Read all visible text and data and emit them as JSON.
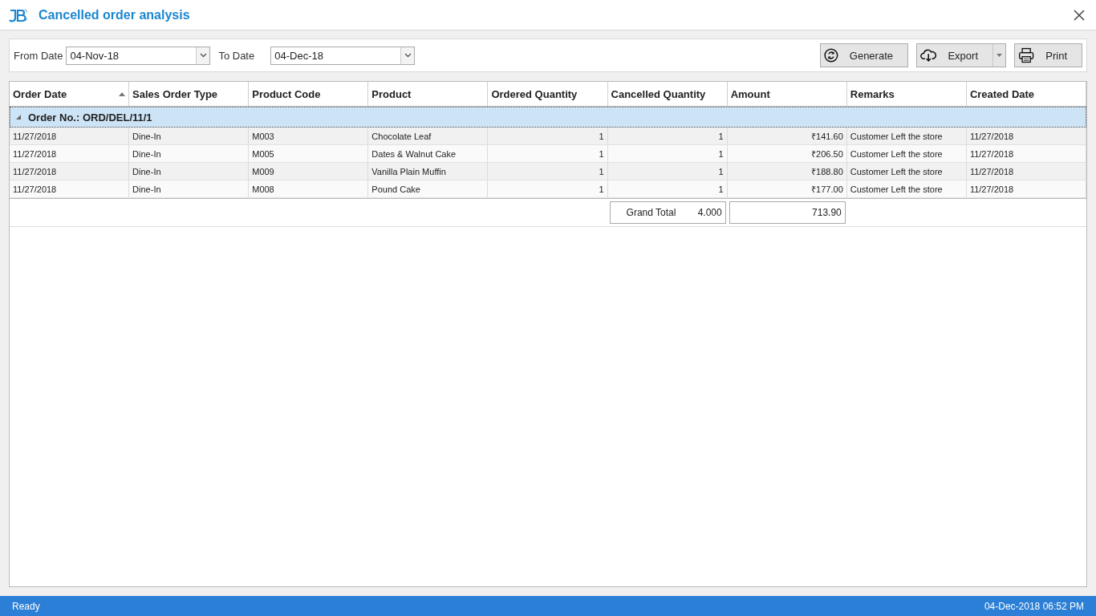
{
  "window": {
    "title": "Cancelled order analysis"
  },
  "filters": [
    {
      "label": "From Date",
      "value": "04-Nov-18"
    },
    {
      "label": "To Date",
      "value": "04-Dec-18"
    }
  ],
  "buttons": [
    {
      "kind": "generate",
      "label": "Generate"
    },
    {
      "kind": "export",
      "label": "Export"
    },
    {
      "kind": "print",
      "label": "Print"
    }
  ],
  "table": {
    "columns": [
      {
        "label": "Order Date",
        "sorted": true
      },
      {
        "label": "Sales Order Type",
        "sorted": false
      },
      {
        "label": "Product Code",
        "sorted": false
      },
      {
        "label": "Product",
        "sorted": false
      },
      {
        "label": "Ordered Quantity",
        "sorted": false
      },
      {
        "label": "Cancelled Quantity",
        "sorted": false
      },
      {
        "label": "Amount",
        "sorted": false
      },
      {
        "label": "Remarks",
        "sorted": false
      },
      {
        "label": "Created Date",
        "sorted": false
      }
    ],
    "group": {
      "label": "Order No.: ORD/DEL/11/1",
      "expanded": true
    },
    "rows": [
      [
        "11/27/2018",
        "Dine-In",
        "M003",
        "Chocolate Leaf",
        "1",
        "1",
        "₹141.60",
        "Customer Left the store",
        "11/27/2018"
      ],
      [
        "11/27/2018",
        "Dine-In",
        "M005",
        "Dates & Walnut Cake",
        "1",
        "1",
        "₹206.50",
        "Customer Left the store",
        "11/27/2018"
      ],
      [
        "11/27/2018",
        "Dine-In",
        "M009",
        "Vanilla Plain Muffin",
        "1",
        "1",
        "₹188.80",
        "Customer Left the store",
        "11/27/2018"
      ],
      [
        "11/27/2018",
        "Dine-In",
        "M008",
        "Pound Cake",
        "1",
        "1",
        "₹177.00",
        "Customer Left the store",
        "11/27/2018"
      ]
    ],
    "summary": {
      "label": "Grand Total",
      "quantity": "4.000",
      "amount": "713.90"
    }
  },
  "status_bar": {
    "left": "Ready",
    "right": "04-Dec-2018 06:52 PM"
  }
}
